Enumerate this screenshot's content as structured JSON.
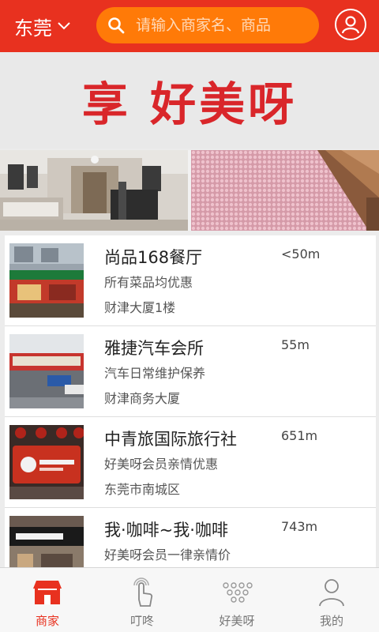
{
  "header": {
    "city": "东莞",
    "search_placeholder": "请输入商家名、商品"
  },
  "banner": {
    "text": "享  好美呀"
  },
  "merchants": [
    {
      "name": "尚品168餐厅",
      "distance": "<50m",
      "desc": "所有菜品均优惠",
      "address": "财津大厦1楼"
    },
    {
      "name": "雅捷汽车会所",
      "distance": "55m",
      "desc": "汽车日常维护保养",
      "address": "财津商务大厦"
    },
    {
      "name": "中青旅国际旅行社",
      "distance": "651m",
      "desc": "好美呀会员亲情优惠",
      "address": "东莞市南城区"
    },
    {
      "name": "我·咖啡~我·咖啡",
      "distance": "743m",
      "desc": "好美呀会员一律亲情价",
      "address": ""
    }
  ],
  "tabs": [
    {
      "label": "商家",
      "icon": "shop-icon",
      "active": true
    },
    {
      "label": "叮咚",
      "icon": "tap-hand-icon",
      "active": false
    },
    {
      "label": "好美呀",
      "icon": "dots-icon",
      "active": false
    },
    {
      "label": "我的",
      "icon": "person-icon",
      "active": false
    }
  ],
  "colors": {
    "brand": "#e8311f",
    "search_bg": "#ff7a08",
    "banner_text": "#d9262a"
  }
}
